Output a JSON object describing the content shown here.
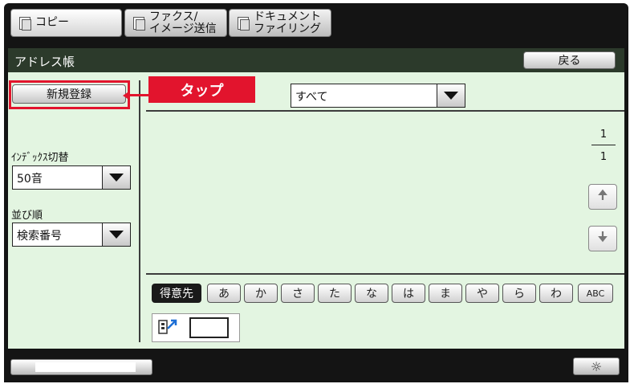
{
  "tabs": [
    {
      "label": "コピー",
      "state": "active"
    },
    {
      "label": "ファクス/\nイメージ送信",
      "state": "inactive"
    },
    {
      "label": "ドキュメント\nファイリング",
      "state": "inactive"
    }
  ],
  "header": {
    "title": "アドレス帳",
    "back_label": "戻る"
  },
  "left": {
    "new_button_label": "新規登録",
    "index_label": "ｲﾝﾃﾞｯｸｽ切替",
    "index_value": "50音",
    "sort_label": "並び順",
    "sort_value": "検索番号"
  },
  "callout": {
    "text": "タップ",
    "color": "#e2142d"
  },
  "filter": {
    "value": "すべて"
  },
  "pager": {
    "current": "1",
    "total": "1"
  },
  "index_buttons": [
    "得意先",
    "あ",
    "か",
    "さ",
    "た",
    "な",
    "は",
    "ま",
    "や",
    "ら",
    "わ",
    "ABC"
  ],
  "colors": {
    "panel_bg": "#e3f5e1",
    "title_bar": "#2c3a2b"
  }
}
